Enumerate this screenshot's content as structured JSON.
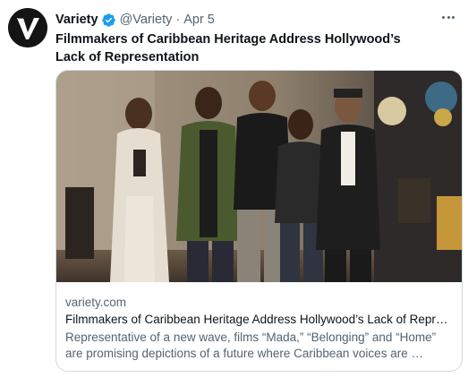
{
  "tweet": {
    "display_name": "Variety",
    "handle": "@Variety",
    "separator": "·",
    "date": "Apr 5",
    "text": "Filmmakers of Caribbean Heritage Address Hollywood’s Lack of Representation",
    "avatar_letter": "V"
  },
  "card": {
    "domain": "variety.com",
    "title": "Filmmakers of Caribbean Heritage Address Hollywood’s Lack of Repre…",
    "description": "Representative of a new wave, films “Mada,” “Belonging” and “Home” are promising depictions of a future where Caribbean voices are …"
  },
  "icons": {
    "verified": "verified-badge-icon",
    "more": "more-options-icon"
  },
  "colors": {
    "verified": "#1d9bf0",
    "secondary_text": "#536471",
    "primary_text": "#0f1419",
    "card_border": "#cfd9de"
  }
}
